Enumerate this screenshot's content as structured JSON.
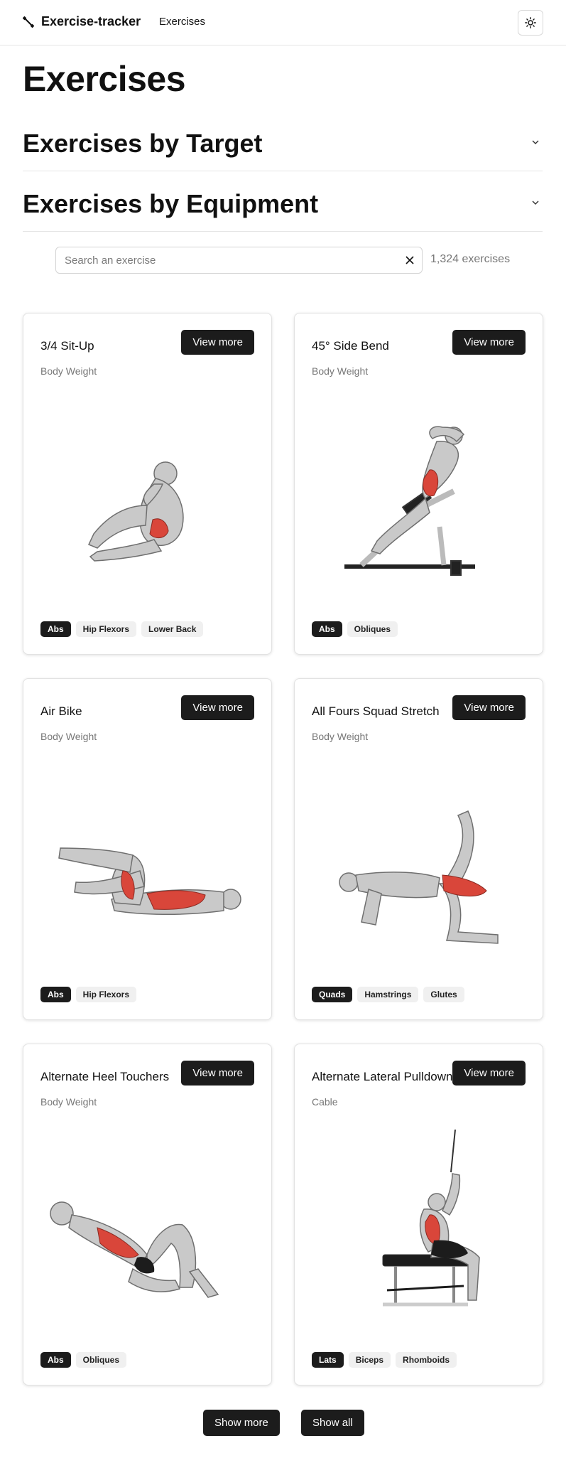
{
  "header": {
    "brand": "Exercise-tracker",
    "nav_exercises": "Exercises",
    "theme_toggle_icon": "sun-icon"
  },
  "page": {
    "title": "Exercises",
    "accordions": [
      {
        "label": "Exercises by Target",
        "expanded": false
      },
      {
        "label": "Exercises by Equipment",
        "expanded": false
      }
    ]
  },
  "search": {
    "placeholder": "Search an exercise",
    "value": "",
    "count": "1,324 exercises"
  },
  "cards": [
    {
      "title": "3/4 Sit-Up",
      "equipment": "Body Weight",
      "button": "View more",
      "tags": [
        "Abs",
        "Hip Flexors",
        "Lower Back"
      ]
    },
    {
      "title": "45° Side Bend",
      "equipment": "Body Weight",
      "button": "View more",
      "tags": [
        "Abs",
        "Obliques"
      ]
    },
    {
      "title": "Air Bike",
      "equipment": "Body Weight",
      "button": "View more",
      "tags": [
        "Abs",
        "Hip Flexors"
      ]
    },
    {
      "title": "All Fours Squad Stretch",
      "equipment": "Body Weight",
      "button": "View more",
      "tags": [
        "Quads",
        "Hamstrings",
        "Glutes"
      ]
    },
    {
      "title": "Alternate Heel Touchers",
      "equipment": "Body Weight",
      "button": "View more",
      "tags": [
        "Abs",
        "Obliques"
      ]
    },
    {
      "title": "Alternate Lateral Pulldown",
      "equipment": "Cable",
      "button": "View more",
      "tags": [
        "Lats",
        "Biceps",
        "Rhomboids"
      ]
    }
  ],
  "footer": {
    "show_more": "Show more",
    "show_all": "Show all"
  },
  "colors": {
    "primary_button": "#1c1c1c",
    "muscle_highlight": "#d9463a",
    "muted_text": "#777777"
  }
}
